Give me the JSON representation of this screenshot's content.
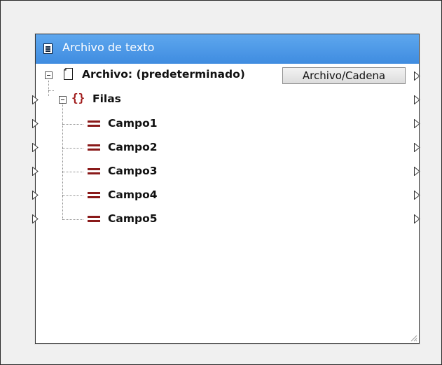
{
  "component": {
    "title": "Archivo de texto",
    "root_label": "Archivo: (predeterminado)",
    "file_button_label": "Archivo/Cadena",
    "group_label": "Filas",
    "fields": [
      "Campo1",
      "Campo2",
      "Campo3",
      "Campo4",
      "Campo5"
    ]
  },
  "colors": {
    "titlebar": "#4a98e8",
    "field_icon": "#8a1a1a",
    "curly_icon": "#a01a1a"
  }
}
